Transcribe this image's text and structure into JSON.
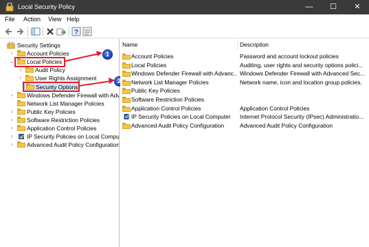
{
  "window": {
    "title": "Local Security Policy"
  },
  "menu": [
    "File",
    "Action",
    "View",
    "Help"
  ],
  "toolbar": {
    "icons": [
      "back-arrow-icon",
      "forward-arrow-icon",
      "show-hide-tree-icon",
      "delete-icon",
      "export-list-icon",
      "help-icon",
      "properties-icon"
    ]
  },
  "tree": {
    "root": "Security Settings",
    "items": [
      {
        "label": "Account Policies"
      },
      {
        "label": "Local Policies"
      },
      {
        "label": "Audit Policy"
      },
      {
        "label": "User Rights Assignment"
      },
      {
        "label": "Security Options"
      },
      {
        "label": "Windows Defender Firewall with Adva"
      },
      {
        "label": "Network List Manager Policies"
      },
      {
        "label": "Public Key Policies"
      },
      {
        "label": "Software Restriction Policies"
      },
      {
        "label": "Application Control Policies"
      },
      {
        "label": "IP Security Policies on Local Compute"
      },
      {
        "label": "Advanced Audit Policy Configuration"
      }
    ]
  },
  "list": {
    "headers": {
      "name": "Name",
      "description": "Description"
    },
    "rows": [
      {
        "name": "Account Policies",
        "description": "Password and account lockout policies",
        "icon": "folder-lock"
      },
      {
        "name": "Local Policies",
        "description": "Auditing, user rights and security options polici...",
        "icon": "folder-lock"
      },
      {
        "name": "Windows Defender Firewall with Advanc...",
        "description": "Windows Defender Firewall with Advanced Sec...",
        "icon": "folder"
      },
      {
        "name": "Network List Manager Policies",
        "description": "Network name, icon and location group policies.",
        "icon": "folder"
      },
      {
        "name": "Public Key Policies",
        "description": "",
        "icon": "folder"
      },
      {
        "name": "Software Restriction Policies",
        "description": "",
        "icon": "folder"
      },
      {
        "name": "Application Control Policies",
        "description": "Application Control Policies",
        "icon": "folder"
      },
      {
        "name": "IP Security Policies on Local Computer",
        "description": "Internet Protocol Security (IPsec) Administratio...",
        "icon": "ipsec"
      },
      {
        "name": "Advanced Audit Policy Configuration",
        "description": "Advanced Audit Policy Configuration",
        "icon": "folder"
      }
    ]
  },
  "annotations": {
    "badge1": "1",
    "badge2": "2",
    "color": "#e31d2a"
  },
  "colors": {
    "titlebar": "#3a3a3a",
    "selection": "#cce6f7",
    "folder": "#f4c64c",
    "highlight": "#e31d2a"
  }
}
